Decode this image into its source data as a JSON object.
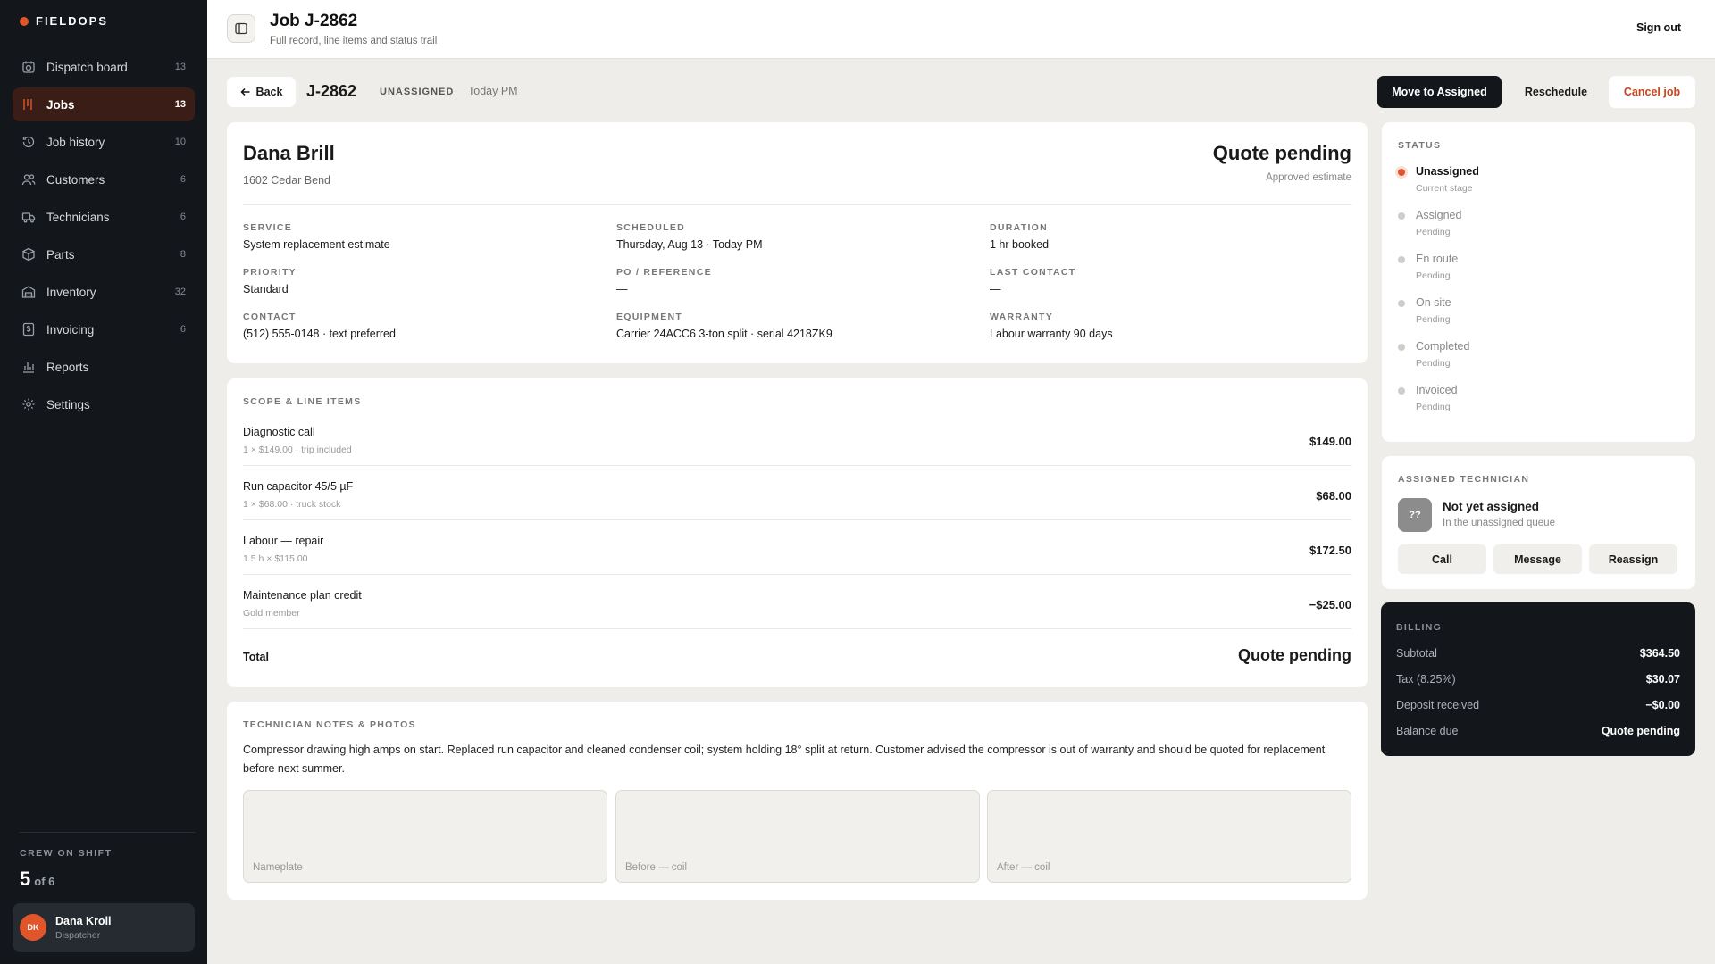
{
  "brand": {
    "name": "FIELDOPS",
    "accent": "#e0562a"
  },
  "sidebar": {
    "items": [
      {
        "label": "Dispatch board",
        "count": "13",
        "icon": "dispatch-icon"
      },
      {
        "label": "Jobs",
        "count": "13",
        "icon": "jobs-icon",
        "active": true
      },
      {
        "label": "Job history",
        "count": "10",
        "icon": "history-icon"
      },
      {
        "label": "Customers",
        "count": "6",
        "icon": "customers-icon"
      },
      {
        "label": "Technicians",
        "count": "6",
        "icon": "truck-icon"
      },
      {
        "label": "Parts",
        "count": "8",
        "icon": "box-icon"
      },
      {
        "label": "Inventory",
        "count": "32",
        "icon": "inventory-icon"
      },
      {
        "label": "Invoicing",
        "count": "6",
        "icon": "invoice-icon"
      },
      {
        "label": "Reports",
        "count": "",
        "icon": "reports-icon"
      },
      {
        "label": "Settings",
        "count": "",
        "icon": "gear-icon"
      }
    ],
    "crew": {
      "label": "CREW ON SHIFT",
      "count": "5",
      "of": "of 6"
    },
    "user": {
      "initials": "DK",
      "name": "Dana Kroll",
      "role": "Dispatcher"
    }
  },
  "header": {
    "title": "Job J-2862",
    "subtitle": "Full record, line items and status trail",
    "sign_out": "Sign out"
  },
  "actions": {
    "back": "Back",
    "job_id": "J-2862",
    "status": "UNASSIGNED",
    "when": "Today PM",
    "primary": "Move to Assigned",
    "reschedule": "Reschedule",
    "cancel": "Cancel job"
  },
  "customer": {
    "name": "Dana Brill",
    "address": "1602 Cedar Bend",
    "quote_status": "Quote pending",
    "quote_sub": "Approved estimate",
    "fields": [
      {
        "label": "SERVICE",
        "value": "System replacement estimate"
      },
      {
        "label": "SCHEDULED",
        "value": "Thursday, Aug 13 · Today PM"
      },
      {
        "label": "DURATION",
        "value": "1 hr booked"
      },
      {
        "label": "PRIORITY",
        "value": "Standard"
      },
      {
        "label": "PO / REFERENCE",
        "value": "—"
      },
      {
        "label": "LAST CONTACT",
        "value": "—"
      },
      {
        "label": "CONTACT",
        "value": "(512) 555-0148 · text preferred"
      },
      {
        "label": "EQUIPMENT",
        "value": "Carrier 24ACC6 3-ton split · serial 4218ZK9"
      },
      {
        "label": "WARRANTY",
        "value": "Labour warranty 90 days"
      }
    ]
  },
  "scope": {
    "label": "SCOPE & LINE ITEMS",
    "items": [
      {
        "name": "Diagnostic call",
        "detail": "1 × $149.00 · trip included",
        "amount": "$149.00"
      },
      {
        "name": "Run capacitor 45/5 µF",
        "detail": "1 × $68.00 · truck stock",
        "amount": "$68.00"
      },
      {
        "name": "Labour — repair",
        "detail": "1.5 h × $115.00",
        "amount": "$172.50"
      },
      {
        "name": "Maintenance plan credit",
        "detail": "Gold member",
        "amount": "−$25.00"
      }
    ],
    "total_label": "Total",
    "total_value": "Quote pending"
  },
  "notes": {
    "label": "TECHNICIAN NOTES & PHOTOS",
    "text": "Compressor drawing high amps on start. Replaced run capacitor and cleaned condenser coil; system holding 18° split at return. Customer advised the compressor is out of warranty and should be quoted for replacement before next summer.",
    "photos": [
      "Nameplate",
      "Before — coil",
      "After — coil"
    ]
  },
  "status": {
    "label": "STATUS",
    "steps": [
      {
        "name": "Unassigned",
        "sub": "Current stage",
        "current": true
      },
      {
        "name": "Assigned",
        "sub": "Pending"
      },
      {
        "name": "En route",
        "sub": "Pending"
      },
      {
        "name": "On site",
        "sub": "Pending"
      },
      {
        "name": "Completed",
        "sub": "Pending"
      },
      {
        "name": "Invoiced",
        "sub": "Pending"
      }
    ]
  },
  "technician": {
    "label": "ASSIGNED TECHNICIAN",
    "avatar": "??",
    "name": "Not yet assigned",
    "sub": "In the unassigned queue",
    "call": "Call",
    "message": "Message",
    "reassign": "Reassign"
  },
  "billing": {
    "label": "BILLING",
    "rows": [
      {
        "k": "Subtotal",
        "v": "$364.50"
      },
      {
        "k": "Tax (8.25%)",
        "v": "$30.07"
      },
      {
        "k": "Deposit received",
        "v": "−$0.00"
      },
      {
        "k": "Balance due",
        "v": "Quote pending"
      }
    ]
  }
}
